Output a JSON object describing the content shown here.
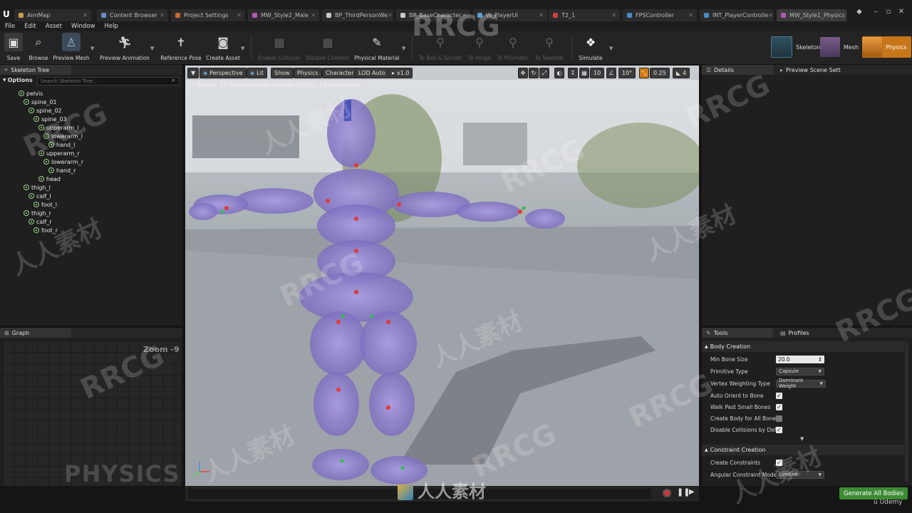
{
  "tabs": [
    {
      "label": "AimMap",
      "color": "#c8a04a"
    },
    {
      "label": "Content Browser",
      "color": "#6a8fc8"
    },
    {
      "label": "Project Settings",
      "color": "#c86a3a"
    },
    {
      "label": "MW_Style2_Male",
      "color": "#b05ab0"
    },
    {
      "label": "BP_ThirdPersonWe",
      "color": "#c8c8c8"
    },
    {
      "label": "BP_BaseCharacter",
      "color": "#c8c8c8"
    },
    {
      "label": "W_PlayerUI",
      "color": "#5aa0d0"
    },
    {
      "label": "T2_1",
      "color": "#d04040"
    },
    {
      "label": "FPSController",
      "color": "#4a8ac8"
    },
    {
      "label": "INT_PlayerControlle",
      "color": "#4a8ac8"
    },
    {
      "label": "MW_Style1_Physics",
      "color": "#b05ab0"
    }
  ],
  "menus": [
    "File",
    "Edit",
    "Asset",
    "Window",
    "Help"
  ],
  "toolbar": {
    "save": "Save",
    "browse": "Browse",
    "preview_mesh": "Preview Mesh",
    "preview_animation": "Preview Animation",
    "reference_pose": "Reference Pose",
    "create_asset": "Create Asset",
    "enable_collision": "Enable Collision",
    "disable_collision": "Disable Collision",
    "physical_material": "Physical Material",
    "to_ball_socket": "To Ball & Socket",
    "to_hinge": "To Hinge",
    "to_prismatic": "To Prismatic",
    "to_skeletal": "To Skeletal",
    "simulate": "Simulate"
  },
  "modes": {
    "skeleton": "Skeleton",
    "mesh": "Mesh",
    "physics": "Physics"
  },
  "skeleton_tree": {
    "title": "Skeleton Tree",
    "options": "Options",
    "search_placeholder": "Search Skeleton Tree...",
    "bones": [
      "pelvis",
      "spine_01",
      "spine_02",
      "spine_03",
      "upperarm_l",
      "lowerarm_l",
      "hand_l",
      "upperarm_r",
      "lowerarm_r",
      "hand_r",
      "head",
      "thigh_l",
      "calf_l",
      "foot_l",
      "thigh_r",
      "calf_r",
      "foot_r"
    ]
  },
  "graph": {
    "title": "Graph",
    "zoom": "Zoom -9",
    "watermark": "PHYSICS"
  },
  "viewport": {
    "perspective": "Perspective",
    "lit": "Lit",
    "show": "Show",
    "physics": "Physics",
    "character": "Character",
    "lod": "LOD Auto",
    "speed": "x1.0",
    "info": "17 Bodies, 17 Considered for bounds (100%), 16 Constraints",
    "grid": "10",
    "angle": "10°",
    "scale": "0.25",
    "cam": "4"
  },
  "details": {
    "title": "Details",
    "preview_scene": "Preview Scene Sett"
  },
  "tools": {
    "title": "Tools",
    "profiles": "Profiles",
    "body_creation": "Body Creation",
    "min_bone_size_label": "Min Bone Size",
    "min_bone_size": "20.0",
    "primitive_type_label": "Primitive Type",
    "primitive_type": "Capsule",
    "vertex_weighting_label": "Vertex Weighting Type",
    "vertex_weighting": "Dominant Weight",
    "auto_orient_label": "Auto Orient to Bone",
    "walk_past_label": "Walk Past Small Bones",
    "create_body_all_label": "Create Body for All Bones",
    "disable_collisions_label": "Disable Collisions by Defa",
    "constraint_creation": "Constraint Creation",
    "create_constraints_label": "Create Constraints",
    "angular_mode_label": "Angular Constraint Mode",
    "angular_mode": "Limited",
    "generate": "Generate All Bodies"
  },
  "watermarks": {
    "rrcg": "RRCG",
    "cn": "人人素材",
    "udemy": "Udemy"
  }
}
